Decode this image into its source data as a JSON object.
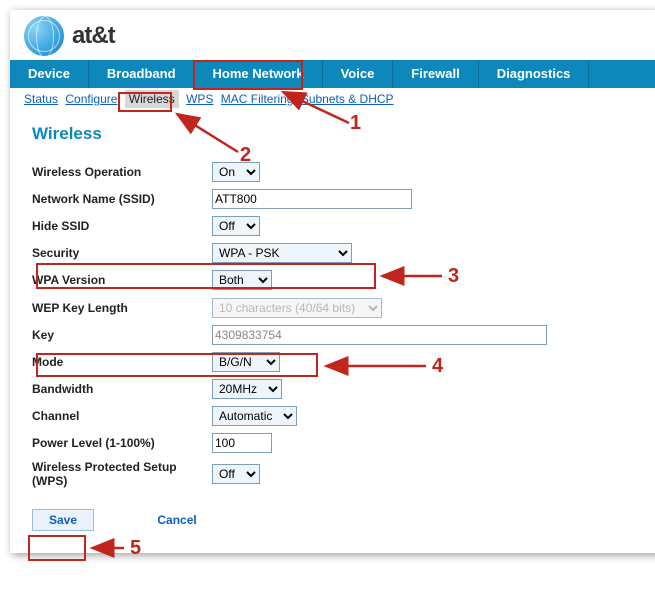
{
  "brand": "at&t",
  "main_nav": [
    "Device",
    "Broadband",
    "Home Network",
    "Voice",
    "Firewall",
    "Diagnostics"
  ],
  "sub_nav": [
    "Status",
    "Configure",
    "Wireless",
    "WPS",
    "MAC Filtering",
    "Subnets & DHCP"
  ],
  "sub_nav_selected": "Wireless",
  "section_title": "Wireless",
  "labels": {
    "wireless_operation": "Wireless Operation",
    "ssid": "Network Name (SSID)",
    "hide_ssid": "Hide SSID",
    "security": "Security",
    "wpa_version": "WPA Version",
    "wep_key_length": "WEP Key Length",
    "key": "Key",
    "mode": "Mode",
    "bandwidth": "Bandwidth",
    "channel": "Channel",
    "power_level": "Power Level (1-100%)",
    "wps": "Wireless Protected Setup (WPS)"
  },
  "values": {
    "wireless_operation": "On",
    "ssid": "ATT800",
    "hide_ssid": "Off",
    "security": "WPA - PSK",
    "wpa_version": "Both",
    "wep_key_length": "10 characters (40/64 bits)",
    "key": "4309833754",
    "mode": "B/G/N",
    "bandwidth": "20MHz",
    "channel": "Automatic",
    "power_level": "100",
    "wps": "Off"
  },
  "buttons": {
    "save": "Save",
    "cancel": "Cancel"
  },
  "annotations": [
    "1",
    "2",
    "3",
    "4",
    "5"
  ]
}
